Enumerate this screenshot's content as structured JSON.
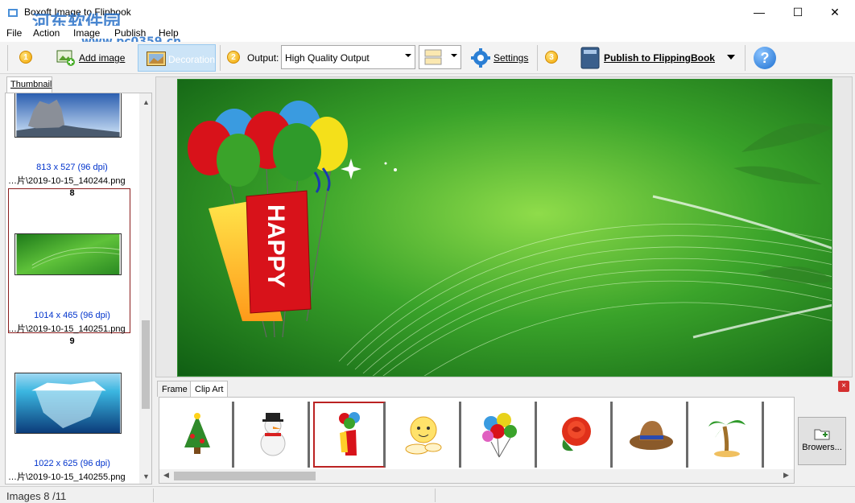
{
  "window": {
    "title": "Boxoft Image to Flipbook",
    "minimize": "—",
    "maximize": "☐",
    "close": "✕"
  },
  "watermark": {
    "logo": "河东软件园",
    "url": "www.pc0359.cn"
  },
  "menu": [
    "File",
    "Action",
    "Image",
    "Publish",
    "Help"
  ],
  "toolbar": {
    "step1": "1",
    "add_image": "Add image",
    "decoration": "Decoration",
    "step2": "2",
    "output_label": "Output:",
    "output_value": "High Quality Output",
    "settings": "Settings",
    "step3": "3",
    "publish": "Publish to FlippingBook",
    "help_icon": "?"
  },
  "thumbnail_panel": {
    "tab": "Thumbnail",
    "items": [
      {
        "dims": "813 x 527 (96 dpi)",
        "file": "…片\\2019-10-15_140244.png",
        "next_num": "8"
      },
      {
        "dims": "1014 x 465 (96 dpi)",
        "file": "…片\\2019-10-15_140251.png",
        "next_num": "9"
      },
      {
        "dims": "1022 x 625 (96 dpi)",
        "file": "…片\\2019-10-15_140255.png"
      }
    ]
  },
  "preview": {
    "banner_text": "HAPPY"
  },
  "bottom_panel": {
    "tabs": [
      "Frame",
      "Clip Art"
    ],
    "close": "×",
    "clip_items": [
      "christmas-tree-icon",
      "snowman-icon",
      "balloons-happy-icon",
      "cartoon-sun-icon",
      "balloon-bunch-icon",
      "rose-icon",
      "cowboy-hat-icon",
      "palm-tree-icon"
    ],
    "browse": "Browers..."
  },
  "status": {
    "images": "Images 8 /11"
  },
  "colors": {
    "accent": "#2a72c8",
    "selection": "#cce4f7",
    "preview_green": "#3aa32a"
  }
}
